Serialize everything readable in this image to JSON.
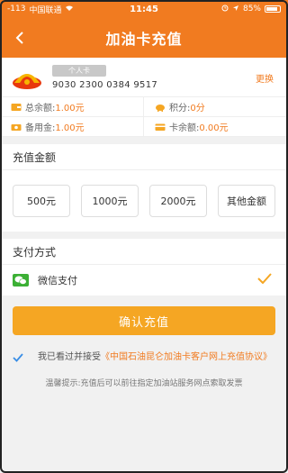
{
  "status_bar": {
    "signal": "-113",
    "carrier": "中国联通",
    "time": "11:45",
    "battery": "85%",
    "battery_level": 0.85
  },
  "nav": {
    "title": "加油卡充值",
    "back_icon": "chevron-left-icon"
  },
  "card": {
    "badge": "个人卡",
    "number": "9030 2300 0384 9517",
    "change_label": "更换"
  },
  "balances": {
    "total_label": "总余额:",
    "total_value": "1.00元",
    "points_label": "积分:",
    "points_value": "0分",
    "reserve_label": "备用金:",
    "reserve_value": "1.00元",
    "card_label": "卡余额:",
    "card_value": "0.00元"
  },
  "recharge": {
    "title": "充值金额",
    "options": [
      "500元",
      "1000元",
      "2000元",
      "其他金额"
    ]
  },
  "payment": {
    "title": "支付方式",
    "method": "微信支付",
    "selected": true
  },
  "confirm_label": "确认充值",
  "agreement": {
    "prefix": "我已看过并接受",
    "link": "《中国石油昆仑加油卡客户网上充值协议》",
    "checked": true
  },
  "tip": "温馨提示:充值后可以前往指定加油站服务网点索取发票",
  "colors": {
    "brand": "#f17b20",
    "button": "#f5a623",
    "wechat": "#3cb035"
  }
}
